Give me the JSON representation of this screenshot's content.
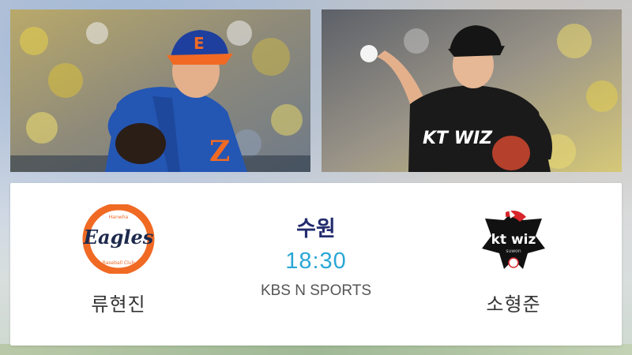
{
  "colors": {
    "venue_text": "#232c6e",
    "time_text": "#2aa7d6",
    "name_text": "#333333",
    "eagles_orange": "#f06a24",
    "eagles_navy": "#1d2a4d",
    "wiz_black": "#111111",
    "wiz_red": "#d8262c"
  },
  "home": {
    "team_logo": {
      "wordmark": "Eagles",
      "arc_top": "Hanwha",
      "arc_bottom": "Baseball Club",
      "icon": "eagles-logo"
    },
    "pitcher": "류현진",
    "photo": {
      "cap_letter": "E",
      "jersey_letter": "Z"
    }
  },
  "away": {
    "team_logo": {
      "wordmark": "kt wiz",
      "sub": "suwon",
      "icon": "kt-wiz-logo"
    },
    "pitcher": "소형준",
    "photo": {
      "jersey_text": "KT WIZ"
    }
  },
  "game": {
    "venue": "수원",
    "time": "18:30",
    "broadcaster": "KBS N SPORTS"
  }
}
